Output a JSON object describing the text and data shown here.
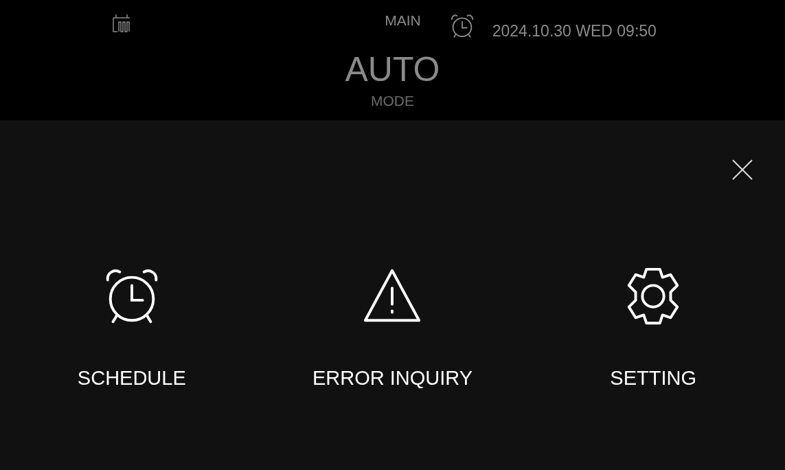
{
  "header": {
    "title": "MAIN",
    "datetime": "2024.10.30 WED 09:50",
    "mode_value": "AUTO",
    "mode_label": "MODE"
  },
  "menu": {
    "items": [
      {
        "kind": "alarm",
        "label": "SCHEDULE"
      },
      {
        "kind": "warning",
        "label": "ERROR INQUIRY"
      },
      {
        "kind": "gear",
        "label": "SETTING"
      }
    ]
  }
}
